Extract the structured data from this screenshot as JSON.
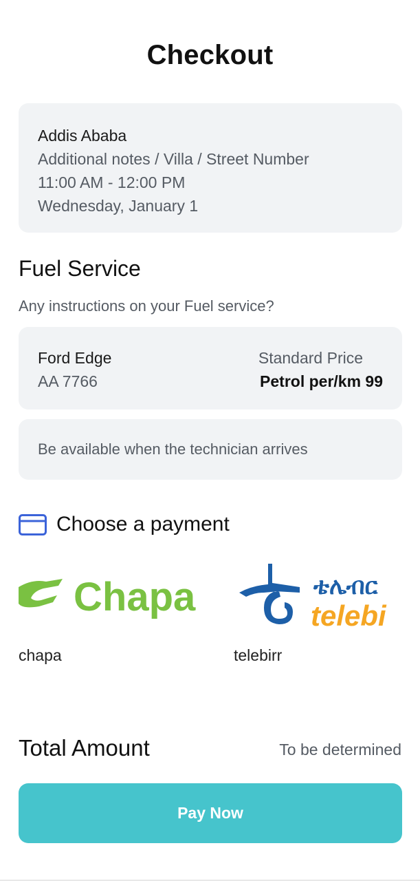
{
  "header": {
    "title": "Checkout"
  },
  "address": {
    "city": "Addis Ababa",
    "notes": "Additional notes / Villa / Street Number",
    "time": "11:00 AM - 12:00 PM",
    "date": "Wednesday, January 1"
  },
  "service": {
    "title": "Fuel Service",
    "subtitle": "Any instructions on your Fuel service?"
  },
  "vehicle": {
    "name": "Ford Edge",
    "plate": "AA 7766",
    "price_label": "Standard Price",
    "price_value": "Petrol per/km 99"
  },
  "instructions": {
    "text": "Be available when the technician arrives"
  },
  "payment": {
    "title": "Choose a payment",
    "icon": "credit-card-icon",
    "options": [
      {
        "label": "chapa",
        "logo_text": "Chapa",
        "logo_color": "#7ac142"
      },
      {
        "label": "telebirr",
        "logo_text_top": "ቴሌብር",
        "logo_text_bottom": "telebi",
        "logo_color_top": "#1d5fa8",
        "logo_color_bottom": "#f5a623"
      }
    ]
  },
  "total": {
    "label": "Total Amount",
    "value": "To be determined"
  },
  "actions": {
    "pay_label": "Pay Now"
  },
  "colors": {
    "accent": "#46c4cc",
    "card_bg": "#f1f3f5",
    "icon_blue": "#3b63d9"
  }
}
